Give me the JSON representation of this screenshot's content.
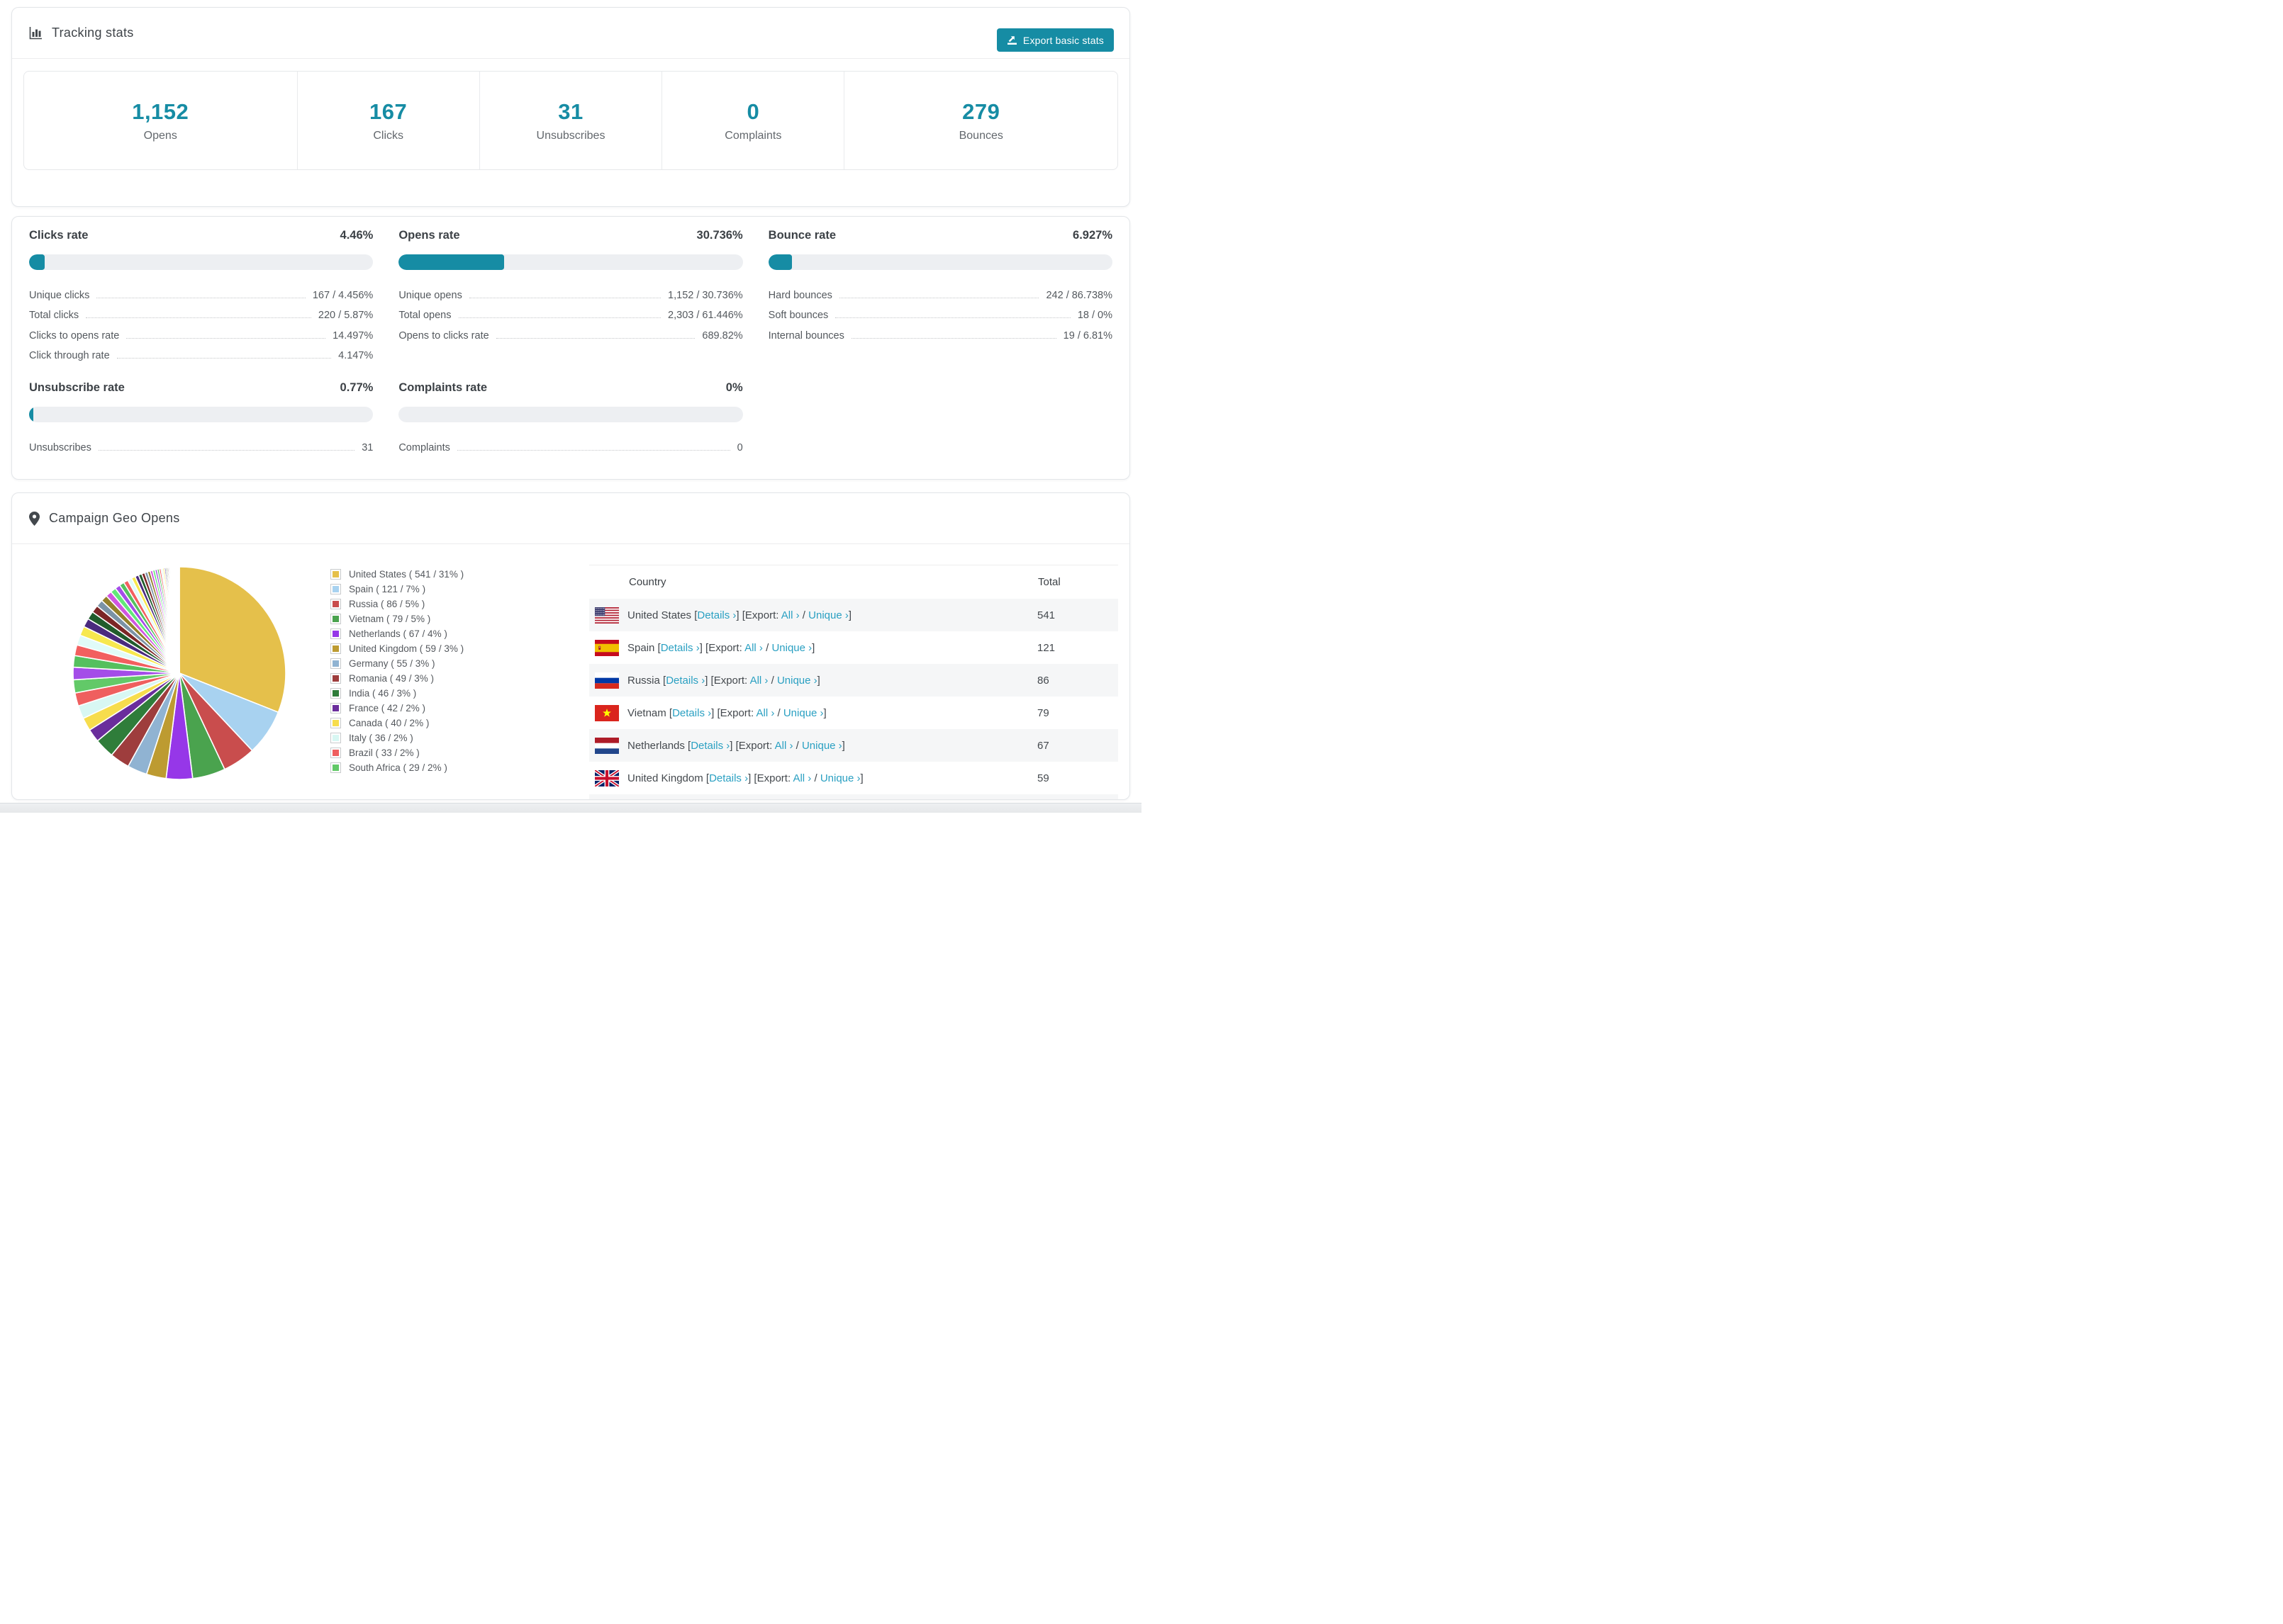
{
  "tracking": {
    "title": "Tracking stats",
    "export_label": "Export basic stats",
    "summary": [
      {
        "value": "1,152",
        "label": "Opens"
      },
      {
        "value": "167",
        "label": "Clicks"
      },
      {
        "value": "31",
        "label": "Unsubscribes"
      },
      {
        "value": "0",
        "label": "Complaints"
      },
      {
        "value": "279",
        "label": "Bounces"
      }
    ]
  },
  "rates": [
    {
      "title": "Clicks rate",
      "value": "4.46%",
      "percent": 4.46,
      "rows": [
        {
          "label": "Unique clicks",
          "value": "167 / 4.456%"
        },
        {
          "label": "Total clicks",
          "value": "220 / 5.87%"
        },
        {
          "label": "Clicks to opens rate",
          "value": "14.497%"
        },
        {
          "label": "Click through rate",
          "value": "4.147%"
        }
      ]
    },
    {
      "title": "Opens rate",
      "value": "30.736%",
      "percent": 30.736,
      "rows": [
        {
          "label": "Unique opens",
          "value": "1,152 / 30.736%"
        },
        {
          "label": "Total opens",
          "value": "2,303 / 61.446%"
        },
        {
          "label": "Opens to clicks rate",
          "value": "689.82%"
        }
      ]
    },
    {
      "title": "Bounce rate",
      "value": "6.927%",
      "percent": 6.927,
      "rows": [
        {
          "label": "Hard bounces",
          "value": "242 / 86.738%"
        },
        {
          "label": "Soft bounces",
          "value": "18 / 0%"
        },
        {
          "label": "Internal bounces",
          "value": "19 / 6.81%"
        }
      ]
    },
    {
      "title": "Unsubscribe rate",
      "value": "0.77%",
      "percent": 0.77,
      "rows": [
        {
          "label": "Unsubscribes",
          "value": "31"
        }
      ]
    },
    {
      "title": "Complaints rate",
      "value": "0%",
      "percent": 0,
      "rows": [
        {
          "label": "Complaints",
          "value": "0"
        }
      ]
    }
  ],
  "geo": {
    "title": "Campaign Geo Opens",
    "chart_data": {
      "type": "pie",
      "title": "Campaign Geo Opens",
      "legend_position": "right",
      "labels": [
        "United States",
        "Spain",
        "Russia",
        "Vietnam",
        "Netherlands",
        "United Kingdom",
        "Germany",
        "Romania",
        "India",
        "France",
        "Canada",
        "Italy",
        "Brazil",
        "South Africa"
      ],
      "values": [
        541,
        121,
        86,
        79,
        67,
        59,
        55,
        49,
        46,
        42,
        40,
        36,
        33,
        29
      ],
      "percents": [
        31,
        7,
        5,
        5,
        4,
        3,
        3,
        3,
        3,
        2,
        2,
        2,
        2,
        2
      ],
      "colors": [
        "#e5c04b",
        "#a8d2f0",
        "#c94d4d",
        "#4aa34e",
        "#9637e8",
        "#bd9b31",
        "#90b3d2",
        "#9e3d3d",
        "#2f7d3a",
        "#6a2d9c",
        "#f7dd4d",
        "#d8f7f3",
        "#ef5f5f",
        "#62c968"
      ],
      "others": {
        "percent": 26,
        "slice_count": 45,
        "decay": 0.93,
        "palette": [
          "#a44de8",
          "#55c05e",
          "#f25f5f",
          "#e0fbf8",
          "#f7e84e",
          "#4a2a7e",
          "#205c2c",
          "#7c2626",
          "#7b93a6",
          "#94802a",
          "#d055e0",
          "#62e878"
        ]
      }
    },
    "legend_format": {
      "open": "( ",
      "sep": " / ",
      "close": "% )"
    },
    "table": {
      "columns": [
        "Country",
        "Total"
      ],
      "link_labels": {
        "details": "Details ›",
        "export_prefix": "[Export:",
        "all": "All ›",
        "unique": "Unique ›"
      },
      "rows": [
        {
          "country": "United States",
          "flag": "us",
          "total": "541"
        },
        {
          "country": "Spain",
          "flag": "es",
          "total": "121"
        },
        {
          "country": "Russia",
          "flag": "ru",
          "total": "86"
        },
        {
          "country": "Vietnam",
          "flag": "vn",
          "total": "79"
        },
        {
          "country": "Netherlands",
          "flag": "nl",
          "total": "67"
        },
        {
          "country": "United Kingdom",
          "flag": "gb",
          "total": "59"
        },
        {
          "country": "",
          "flag": "de",
          "total": ""
        }
      ]
    }
  },
  "colors": {
    "accent": "#168ca4",
    "link": "#2aa0c2",
    "bar_bg": "#edeff2",
    "row_stripe": "#f5f6f7"
  }
}
